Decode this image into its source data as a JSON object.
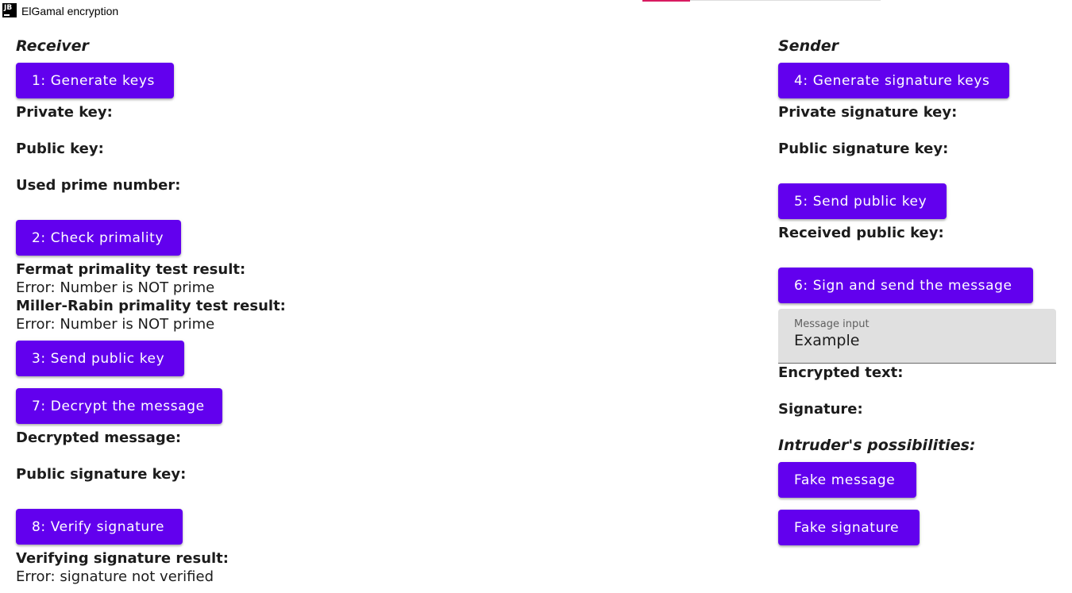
{
  "window": {
    "title": "ElGamal encryption",
    "icon_text": "JB"
  },
  "colors": {
    "button": "#6200ee",
    "button_text": "#ffffff",
    "tab_indicator": "#d81b60",
    "text": "#1c1c1c",
    "field_background": "#e0e0e0"
  },
  "receiver": {
    "heading": "Receiver",
    "generate_keys_button": "1: Generate keys",
    "private_key_label": "Private key:",
    "public_key_label": "Public key:",
    "used_prime_label": "Used prime number:",
    "check_primality_button": "2: Check primality",
    "fermat_label": "Fermat primality test result:",
    "fermat_result": "Error: Number is NOT prime",
    "miller_rabin_label": "Miller-Rabin primality test result:",
    "miller_rabin_result": "Error: Number is NOT prime",
    "send_public_key_button": "3: Send public key",
    "decrypt_button": "7: Decrypt the message",
    "decrypted_message_label": "Decrypted message:",
    "public_signature_key_label": "Public signature key:",
    "verify_signature_button": "8: Verify signature",
    "verifying_result_label": "Verifying signature result:",
    "verifying_result": "Error: signature not verified"
  },
  "sender": {
    "heading": "Sender",
    "generate_signature_keys_button": "4: Generate signature keys",
    "private_signature_key_label": "Private signature key:",
    "public_signature_key_label": "Public signature key:",
    "send_public_key_button": "5: Send public key",
    "received_public_key_label": "Received public key:",
    "sign_and_send_button": "6: Sign and send the message",
    "message_input": {
      "label": "Message input",
      "value": "Example"
    },
    "encrypted_text_label": "Encrypted text:",
    "signature_label": "Signature:",
    "intruder_heading": "Intruder's possibilities:",
    "fake_message_button": "Fake message",
    "fake_signature_button": "Fake signature"
  }
}
